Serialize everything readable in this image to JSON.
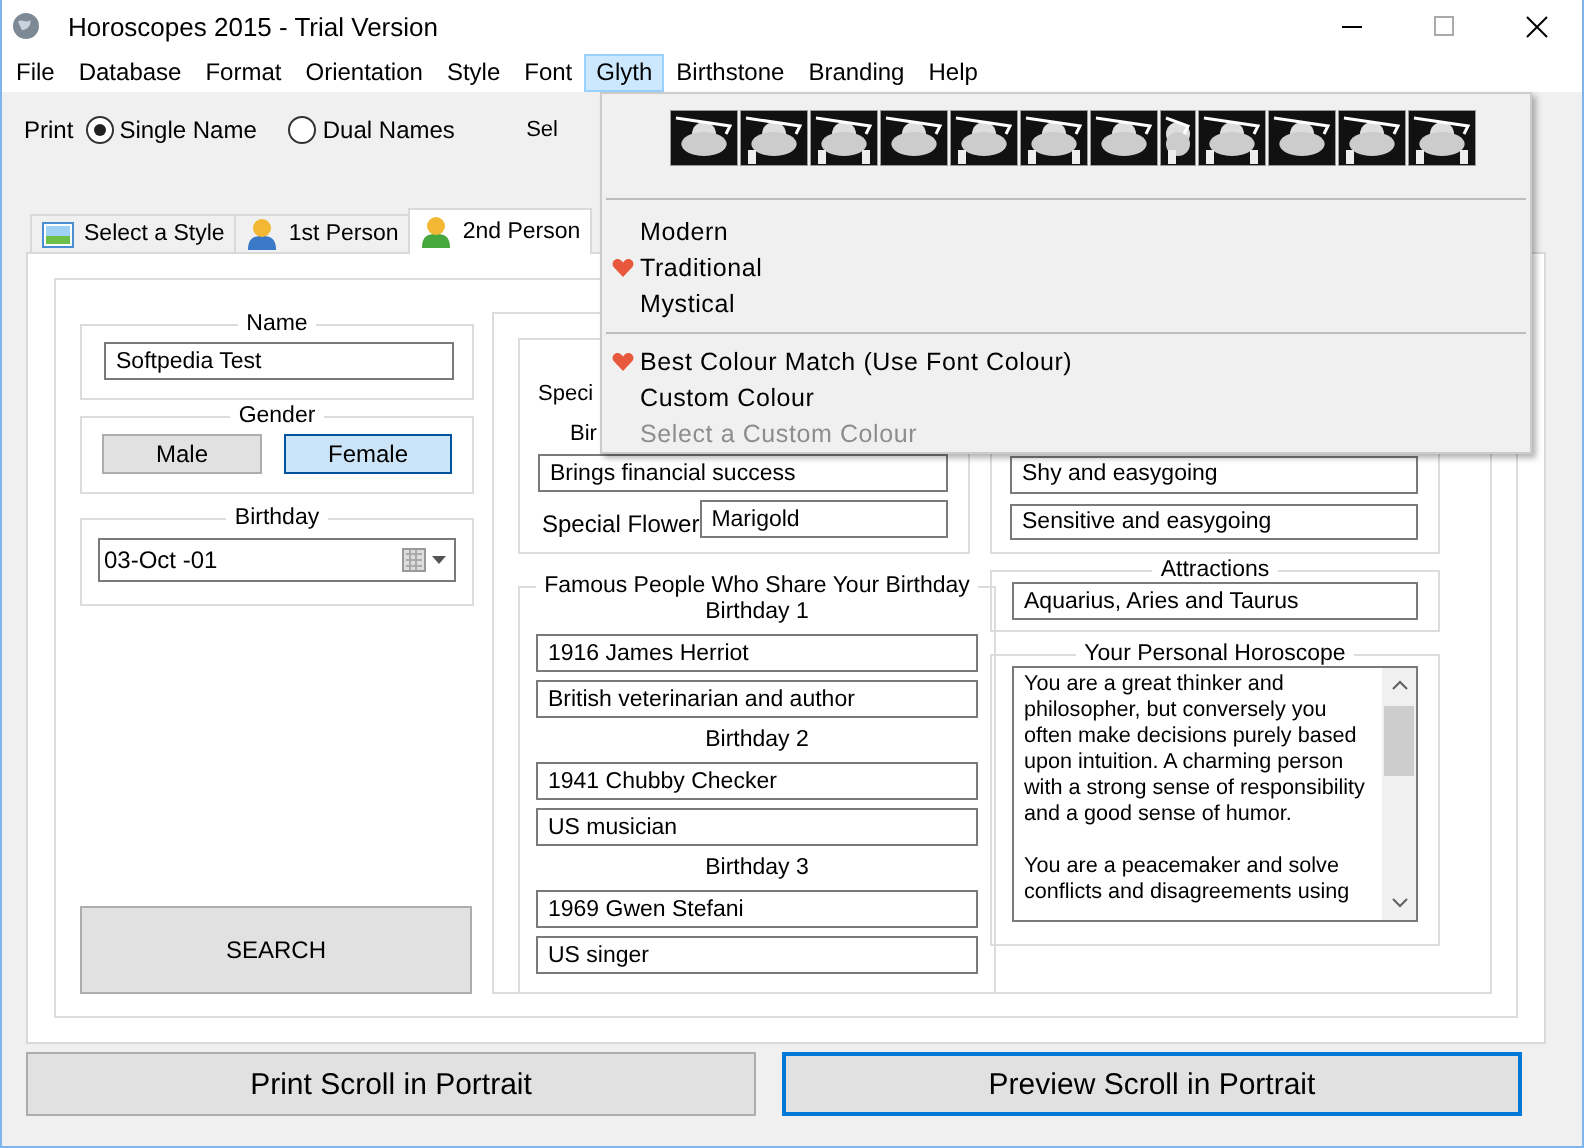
{
  "window": {
    "title": "Horoscopes 2015 - Trial Version"
  },
  "menu": [
    {
      "label": "File",
      "selected": false
    },
    {
      "label": "Database",
      "selected": false
    },
    {
      "label": "Format",
      "selected": false
    },
    {
      "label": "Orientation",
      "selected": false
    },
    {
      "label": "Style",
      "selected": false
    },
    {
      "label": "Font",
      "selected": false
    },
    {
      "label": "Glyth",
      "selected": true
    },
    {
      "label": "Birthstone",
      "selected": false
    },
    {
      "label": "Branding",
      "selected": false
    },
    {
      "label": "Help",
      "selected": false
    }
  ],
  "print_row": {
    "label": "Print",
    "options": [
      {
        "label": "Single Name",
        "selected": true
      },
      {
        "label": "Dual Names",
        "selected": false
      }
    ],
    "select_label": "Sel"
  },
  "tabs": [
    {
      "label": "Select a Style",
      "selected": false,
      "kind": "image"
    },
    {
      "label": "1st Person",
      "selected": false,
      "kind": "person",
      "color": "#3a78c8"
    },
    {
      "label": "2nd Person",
      "selected": true,
      "kind": "person",
      "color": "#46a83c"
    }
  ],
  "name_group": {
    "title": "Name",
    "value": "Softpedia Test"
  },
  "gender_group": {
    "title": "Gender",
    "options": [
      {
        "label": "Male",
        "selected": false
      },
      {
        "label": "Female",
        "selected": true
      }
    ]
  },
  "birthday_group": {
    "title": "Birthday",
    "value": "03-Oct -01"
  },
  "search_button": "SEARCH",
  "birthstone_group": {
    "label_1": "Speci",
    "label_2": "Bir",
    "meaning": "Brings financial success",
    "flower_label": "Special Flower",
    "flower": "Marigold"
  },
  "famous_group": {
    "title": "Famous People Who Share Your Birthday",
    "birthdays": [
      {
        "title": "Birthday 1",
        "name": "1916 James Herriot",
        "description": "British veterinarian and author"
      },
      {
        "title": "Birthday 2",
        "name": "1941 Chubby Checker",
        "description": "US musician"
      },
      {
        "title": "Birthday 3",
        "name": "1969 Gwen Stefani",
        "description": "US singer"
      }
    ]
  },
  "traits_group": {
    "values": [
      "Shy and easygoing",
      "Sensitive and easygoing"
    ]
  },
  "attractions_group": {
    "title": "Attractions",
    "value": "Aquarius, Aries and Taurus"
  },
  "horoscope_group": {
    "title": "Your Personal Horoscope",
    "paragraphs": [
      "You are a great thinker and philosopher, but conversely you often make decisions purely based upon intuition.  A charming person with a strong sense of responsibility and a good sense of humor.",
      "You are a peacemaker and solve conflicts and disagreements using"
    ]
  },
  "buttons": [
    {
      "label": "Print Scroll in Portrait",
      "focused": false
    },
    {
      "label": "Preview Scroll in Portrait",
      "focused": true
    }
  ],
  "glyth_menu": {
    "sections": [
      [
        {
          "label": "Modern",
          "checked": false,
          "disabled": false
        },
        {
          "label": "Traditional",
          "checked": true,
          "disabled": false
        },
        {
          "label": "Mystical",
          "checked": false,
          "disabled": false
        }
      ],
      [
        {
          "label": "Best Colour Match (Use Font Colour)",
          "checked": true,
          "disabled": false
        },
        {
          "label": "Custom Colour",
          "checked": false,
          "disabled": false
        },
        {
          "label": "Select a Custom Colour",
          "checked": false,
          "disabled": true
        }
      ]
    ]
  }
}
